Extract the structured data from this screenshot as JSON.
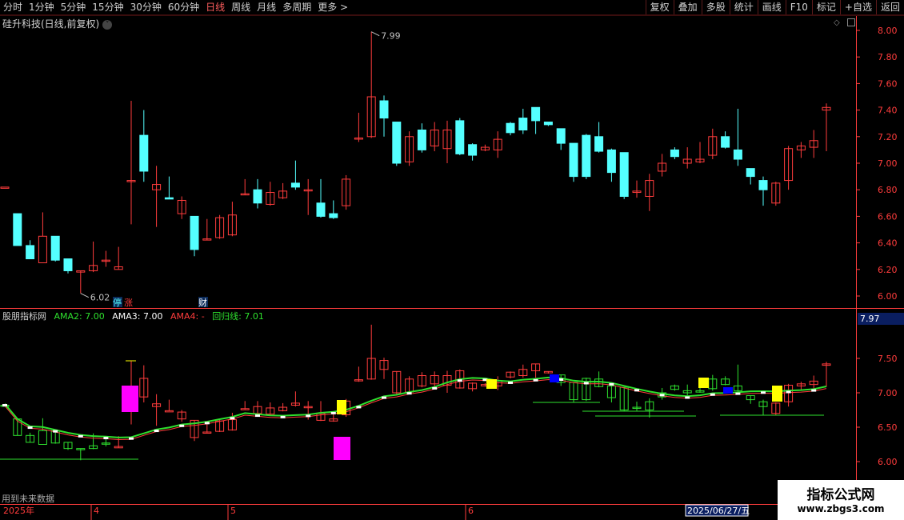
{
  "toolbar": {
    "periods": [
      "分时",
      "1分钟",
      "5分钟",
      "15分钟",
      "30分钟",
      "60分钟",
      "日线",
      "周线",
      "月线",
      "多周期",
      "更多 >"
    ],
    "active": "日线",
    "right": [
      "复权",
      "叠加",
      "多股",
      "统计",
      "画线",
      "F10",
      "标记",
      "+自选",
      "返回"
    ]
  },
  "main_title": "硅升科技(日线,前复权)",
  "price_axis": [
    "8.00",
    "7.80",
    "7.60",
    "7.40",
    "7.20",
    "7.00",
    "6.80",
    "6.60",
    "6.40",
    "6.20",
    "6.00"
  ],
  "high_label": "7.99",
  "low_label": "6.02",
  "markers": {
    "stop": "停",
    "zhang": "涨",
    "cai": "财"
  },
  "indicator": {
    "name": "股朋指标网",
    "ama2": "AMA2: 7.00",
    "ama3": "AMA3: 7.00",
    "ama4": "AMA4: -",
    "huigui": "回归线: 7.01",
    "value_box": "7.97",
    "axis": [
      "7.50",
      "7.00",
      "6.50",
      "6.00"
    ]
  },
  "footer": {
    "note": "用到未来数据",
    "year": "2025年",
    "months": [
      "4",
      "5",
      "6"
    ],
    "date_box": "2025/06/27/五"
  },
  "watermark": {
    "line1": "指标公式网",
    "line2": "www.zbgs3.com"
  },
  "colors": {
    "up": "#ff3c3c",
    "down": "#54ffff",
    "green": "#2ee02e",
    "axis": "#ff3c3c",
    "yellow": "#ffff00",
    "magenta": "#ff00ff",
    "blue": "#0000ff"
  },
  "chart_data": {
    "type": "candlestick",
    "candles": [
      [
        6.82,
        6.82,
        6.62,
        6.62
      ],
      [
        6.62,
        6.38,
        6.38,
        6.62
      ],
      [
        6.38,
        6.28,
        6.28,
        6.42
      ],
      [
        6.25,
        6.45,
        6.45,
        6.63
      ],
      [
        6.45,
        6.27,
        6.26,
        6.45
      ],
      [
        6.28,
        6.19,
        6.17,
        6.28
      ],
      [
        6.18,
        6.19,
        6.02,
        6.19
      ],
      [
        6.19,
        6.23,
        6.18,
        6.41
      ],
      [
        6.27,
        6.27,
        6.22,
        6.34
      ],
      [
        6.2,
        6.22,
        6.2,
        6.37
      ],
      [
        6.87,
        6.87,
        6.54,
        7.47
      ],
      [
        7.21,
        6.94,
        6.86,
        7.4
      ],
      [
        6.8,
        6.84,
        6.52,
        6.98
      ],
      [
        6.74,
        6.73,
        6.74,
        6.9
      ],
      [
        6.62,
        6.72,
        6.58,
        6.75
      ],
      [
        6.6,
        6.35,
        6.3,
        6.6
      ],
      [
        6.43,
        6.43,
        6.42,
        6.58
      ],
      [
        6.44,
        6.59,
        6.43,
        6.61
      ],
      [
        6.46,
        6.61,
        6.45,
        6.71
      ],
      [
        6.77,
        6.77,
        6.76,
        6.88
      ],
      [
        6.8,
        6.7,
        6.66,
        6.88
      ],
      [
        6.69,
        6.78,
        6.68,
        6.86
      ],
      [
        6.74,
        6.79,
        6.73,
        6.85
      ],
      [
        6.85,
        6.82,
        6.8,
        7.02
      ],
      [
        6.8,
        6.8,
        6.61,
        6.88
      ],
      [
        6.7,
        6.6,
        6.59,
        6.88
      ],
      [
        6.62,
        6.59,
        6.58,
        6.72
      ],
      [
        6.68,
        6.88,
        6.65,
        6.91
      ],
      [
        7.19,
        7.19,
        7.16,
        7.38
      ],
      [
        7.2,
        7.5,
        7.19,
        7.99
      ],
      [
        7.47,
        7.34,
        7.2,
        7.51
      ],
      [
        7.31,
        7.0,
        6.98,
        7.31
      ],
      [
        7.01,
        7.2,
        6.98,
        7.24
      ],
      [
        7.25,
        7.1,
        7.08,
        7.3
      ],
      [
        7.13,
        7.25,
        7.09,
        7.31
      ],
      [
        7.11,
        7.25,
        7.0,
        7.32
      ],
      [
        7.32,
        7.07,
        7.06,
        7.34
      ],
      [
        7.14,
        7.06,
        7.02,
        7.15
      ],
      [
        7.1,
        7.12,
        7.09,
        7.14
      ],
      [
        7.1,
        7.18,
        7.04,
        7.24
      ],
      [
        7.3,
        7.23,
        7.21,
        7.31
      ],
      [
        7.34,
        7.25,
        7.22,
        7.41
      ],
      [
        7.42,
        7.32,
        7.22,
        7.42
      ],
      [
        7.31,
        7.29,
        7.28,
        7.31
      ],
      [
        7.26,
        7.15,
        7.1,
        7.26
      ],
      [
        7.15,
        6.9,
        6.86,
        7.15
      ],
      [
        7.21,
        6.9,
        6.88,
        7.22
      ],
      [
        7.2,
        7.09,
        7.08,
        7.31
      ],
      [
        7.1,
        6.93,
        6.86,
        7.11
      ],
      [
        7.08,
        6.75,
        6.73,
        7.08
      ],
      [
        6.78,
        6.79,
        6.74,
        6.87
      ],
      [
        6.75,
        6.87,
        6.64,
        6.92
      ],
      [
        6.94,
        7.0,
        6.9,
        7.07
      ],
      [
        7.1,
        7.05,
        7.03,
        7.12
      ],
      [
        7.0,
        7.03,
        6.96,
        7.12
      ],
      [
        7.01,
        7.03,
        7.0,
        7.16
      ],
      [
        7.06,
        7.2,
        7.03,
        7.26
      ],
      [
        7.2,
        7.12,
        7.11,
        7.24
      ],
      [
        7.1,
        7.03,
        6.98,
        7.41
      ],
      [
        6.96,
        6.9,
        6.84,
        6.96
      ],
      [
        6.87,
        6.8,
        6.68,
        6.9
      ],
      [
        6.7,
        6.85,
        6.68,
        6.86
      ],
      [
        6.87,
        7.11,
        6.8,
        7.13
      ],
      [
        7.1,
        7.13,
        7.04,
        7.16
      ],
      [
        7.12,
        7.17,
        7.04,
        7.25
      ],
      [
        7.4,
        7.42,
        7.09,
        7.45
      ]
    ]
  }
}
